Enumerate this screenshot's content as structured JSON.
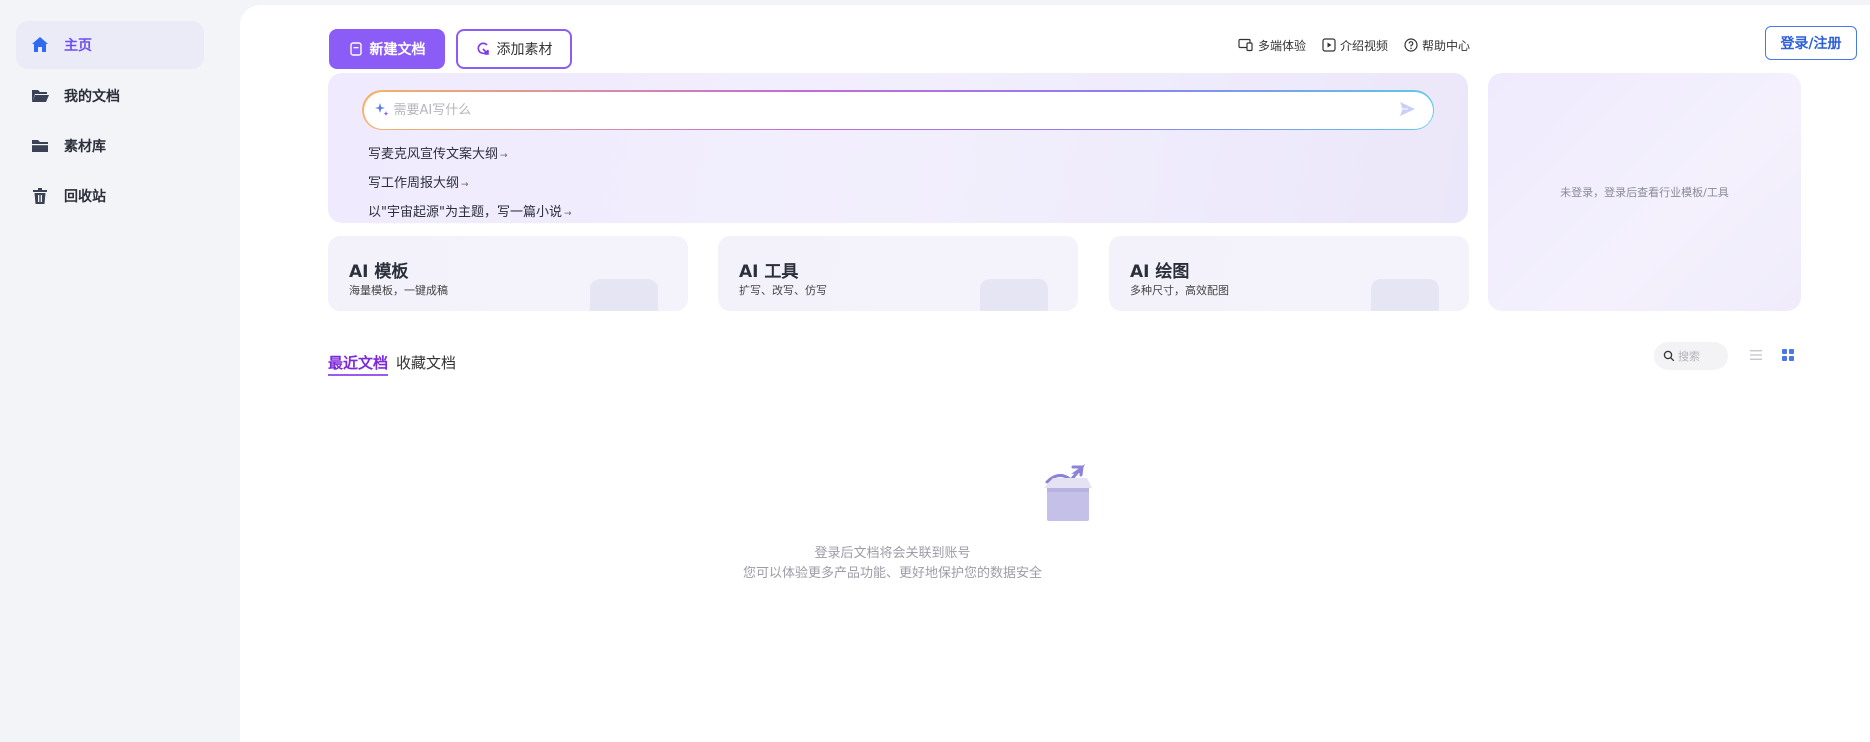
{
  "sidebar": {
    "items": [
      {
        "label": "主页",
        "icon": "home-icon",
        "active": true
      },
      {
        "label": "我的文档",
        "icon": "folder-open-icon",
        "active": false
      },
      {
        "label": "素材库",
        "icon": "folder-icon",
        "active": false
      },
      {
        "label": "回收站",
        "icon": "trash-icon",
        "active": false
      }
    ]
  },
  "toolbar": {
    "new_doc_label": "新建文档",
    "add_material_label": "添加素材"
  },
  "header": {
    "links": [
      {
        "label": "多端体验",
        "icon": "devices-icon"
      },
      {
        "label": "介绍视频",
        "icon": "play-icon"
      },
      {
        "label": "帮助中心",
        "icon": "help-icon"
      }
    ],
    "login_label": "登录/注册"
  },
  "ai_prompt": {
    "placeholder": "需要AI写什么",
    "suggestions": [
      "写麦克风宣传文案大纲",
      "写工作周报大纲",
      "以\"宇宙起源\"为主题，写一篇小说"
    ],
    "suggestion_arrow": "→"
  },
  "right_panel": {
    "message": "未登录，登录后查看行业模板/工具"
  },
  "features": [
    {
      "title": "AI 模板",
      "subtitle": "海量模板，一键成稿"
    },
    {
      "title": "AI 工具",
      "subtitle": "扩写、改写、仿写"
    },
    {
      "title": "AI 绘图",
      "subtitle": "多种尺寸，高效配图"
    }
  ],
  "docs": {
    "tabs": [
      {
        "label": "最近文档",
        "active": true
      },
      {
        "label": "收藏文档",
        "active": false
      }
    ],
    "search_placeholder": "搜索",
    "empty_line1": "登录后文档将会关联到账号",
    "empty_line2": "您可以体验更多产品功能、更好地保护您的数据安全"
  },
  "colors": {
    "accent": "#8b5cf6",
    "login_blue": "#2b5fd9",
    "active_tab": "#7c2ad9"
  }
}
